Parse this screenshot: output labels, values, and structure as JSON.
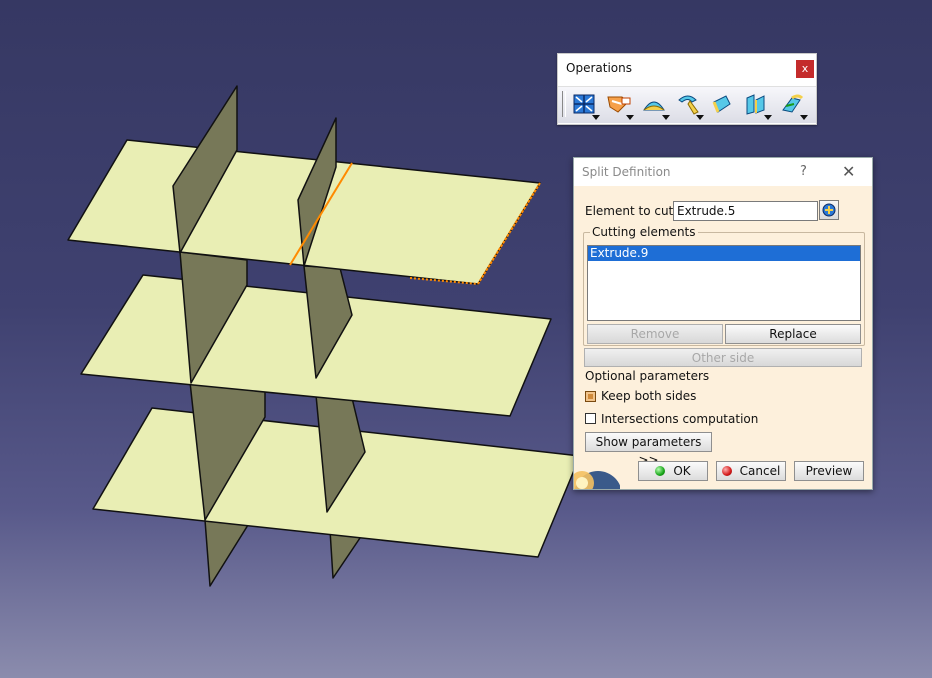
{
  "toolbar": {
    "title": "Operations",
    "close_label": "x",
    "tools": [
      {
        "name": "join-icon"
      },
      {
        "name": "healing-icon"
      },
      {
        "name": "split-icon"
      },
      {
        "name": "trim-icon"
      },
      {
        "name": "boundary-icon"
      },
      {
        "name": "extract-icon"
      },
      {
        "name": "fillet-icon"
      }
    ]
  },
  "dialog": {
    "title": "Split Definition",
    "help_label": "?",
    "close_label": "✕",
    "element_to_cut_label": "Element to cut:",
    "element_to_cut_value": "Extrude.5",
    "cutting_elements_label": "Cutting elements",
    "cutting_elements": [
      "Extrude.9"
    ],
    "remove_label": "Remove",
    "replace_label": "Replace",
    "other_side_label": "Other side",
    "optional_parameters_label": "Optional parameters",
    "keep_both_sides_label": "Keep both sides",
    "keep_both_sides_checked": true,
    "intersections_label": "Intersections computation",
    "intersections_checked": false,
    "show_parameters_label": "Show parameters >>",
    "ok_label": "OK",
    "cancel_label": "Cancel",
    "preview_label": "Preview"
  },
  "colors": {
    "plane_fill": "#e9eeb4",
    "wall_fill": "#777858",
    "highlight": "#ff8a00"
  }
}
